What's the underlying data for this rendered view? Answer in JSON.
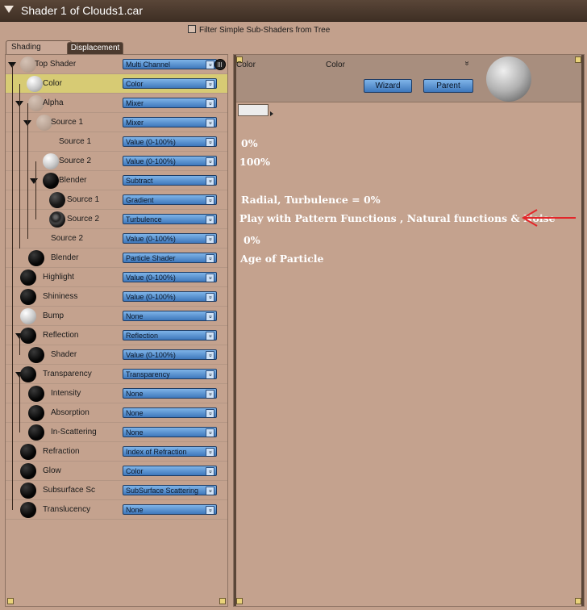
{
  "window": {
    "title": "Shader 1 of Clouds1.car"
  },
  "filter": {
    "label": "Filter Simple Sub-Shaders from Tree",
    "checked": false
  },
  "tabs": [
    {
      "label": "Shading",
      "active": true
    },
    {
      "label": "Displacement",
      "active": false
    }
  ],
  "tree": [
    {
      "label": "Top Shader",
      "value": "Multi Channel",
      "icon": "light-sphere"
    },
    {
      "label": "Color",
      "value": "Color",
      "icon": "white-sphere",
      "selected": true
    },
    {
      "label": "Alpha",
      "value": "Mixer",
      "icon": "light-sphere"
    },
    {
      "label": "Source 1",
      "value": "Mixer",
      "icon": "light-sphere"
    },
    {
      "label": "Source 1",
      "value": "Value (0-100%)",
      "icon": "none"
    },
    {
      "label": "Source 2",
      "value": "Value (0-100%)",
      "icon": "white-sphere"
    },
    {
      "label": "Blender",
      "value": "Subtract",
      "icon": "black-sphere"
    },
    {
      "label": "Source 1",
      "value": "Gradient",
      "icon": "gradient-sphere"
    },
    {
      "label": "Source 2",
      "value": "Turbulence",
      "icon": "turbulence-sphere"
    },
    {
      "label": "Source 2",
      "value": "Value (0-100%)",
      "icon": "none"
    },
    {
      "label": "Blender",
      "value": "Particle Shader",
      "icon": "black-sphere"
    },
    {
      "label": "Highlight",
      "value": "Value (0-100%)",
      "icon": "black-sphere"
    },
    {
      "label": "Shininess",
      "value": "Value (0-100%)",
      "icon": "black-sphere"
    },
    {
      "label": "Bump",
      "value": "None",
      "icon": "white-sphere"
    },
    {
      "label": "Reflection",
      "value": "Reflection",
      "icon": "black-sphere"
    },
    {
      "label": "Shader",
      "value": "Value (0-100%)",
      "icon": "black-sphere"
    },
    {
      "label": "Transparency",
      "value": "Transparency",
      "icon": "black-sphere"
    },
    {
      "label": "Intensity",
      "value": "None",
      "icon": "black-sphere"
    },
    {
      "label": "Absorption",
      "value": "None",
      "icon": "black-sphere"
    },
    {
      "label": "In-Scattering",
      "value": "None",
      "icon": "black-sphere"
    },
    {
      "label": "Refraction",
      "value": "Index of Refraction",
      "icon": "black-sphere"
    },
    {
      "label": "Glow",
      "value": "Color",
      "icon": "black-sphere"
    },
    {
      "label": "Subsurface Sc",
      "value": "SubSurface Scattering",
      "icon": "black-sphere"
    },
    {
      "label": "Translucency",
      "value": "None",
      "icon": "black-sphere"
    }
  ],
  "right_panel": {
    "channel_label": "Color",
    "type_label": "Color",
    "chevron": "»",
    "wizard_label": "Wizard",
    "parent_label": "Parent",
    "swatch_color": "#ececec"
  },
  "notes": [
    "0%",
    "100%",
    "Radial, Turbulence = 0%",
    "Play with Pattern Functions , Natural functions & Noise",
    "0%",
    "Age of Particle"
  ],
  "colors": {
    "accent": "#e3262a",
    "selected_row": "#d7cb74",
    "dropdown": "#5b97d6"
  }
}
